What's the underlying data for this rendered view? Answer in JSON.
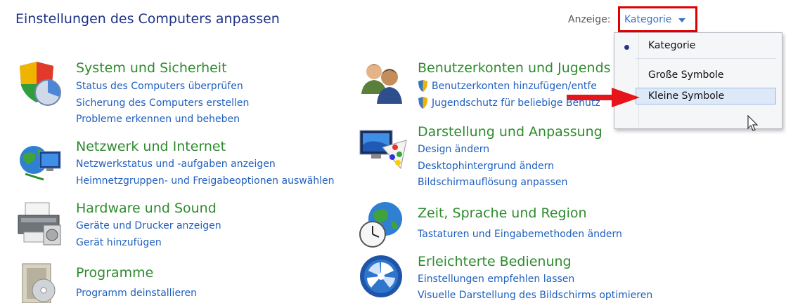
{
  "header": {
    "title": "Einstellungen des Computers anpassen"
  },
  "view": {
    "label": "Anzeige:",
    "value": "Kategorie",
    "options": [
      {
        "label": "Kategorie",
        "selected": true
      },
      {
        "label": "Große Symbole",
        "selected": false
      },
      {
        "label": "Kleine Symbole",
        "selected": false,
        "hovered": true
      }
    ]
  },
  "left": [
    {
      "title": "System und Sicherheit",
      "icon": "shield-chart-icon",
      "links": [
        "Status des Computers überprüfen",
        "Sicherung des Computers erstellen",
        "Probleme erkennen und beheben"
      ]
    },
    {
      "title": "Netzwerk und Internet",
      "icon": "globe-network-icon",
      "links": [
        "Netzwerkstatus und -aufgaben anzeigen",
        "Heimnetzgruppen- und Freigabeoptionen auswählen"
      ]
    },
    {
      "title": "Hardware und Sound",
      "icon": "printer-icon",
      "links": [
        "Geräte und Drucker anzeigen",
        "Gerät hinzufügen"
      ]
    },
    {
      "title": "Programme",
      "icon": "programs-icon",
      "links": [
        "Programm deinstallieren"
      ]
    }
  ],
  "right": [
    {
      "title": "Benutzerkonten und Jugends",
      "icon": "users-icon",
      "links": [
        "Benutzerkonten hinzufügen/entfe",
        "Jugendschutz für beliebige Benutz"
      ]
    },
    {
      "title": "Darstellung und Anpassung",
      "icon": "display-icon",
      "links": [
        "Design ändern",
        "Desktophintergrund ändern",
        "Bildschirmauflösung anpassen"
      ]
    },
    {
      "title": "Zeit, Sprache und Region",
      "icon": "clock-globe-icon",
      "links": [
        "Tastaturen und Eingabemethoden ändern"
      ]
    },
    {
      "title": "Erleichterte Bedienung",
      "icon": "ease-of-access-icon",
      "links": [
        "Einstellungen empfehlen lassen",
        "Visuelle Darstellung des Bildschirms optimieren"
      ]
    }
  ],
  "colors": {
    "title_green": "#2e8b2e",
    "link_blue": "#1f5fbf",
    "header_blue": "#1e3287",
    "highlight_red": "#e00000"
  }
}
